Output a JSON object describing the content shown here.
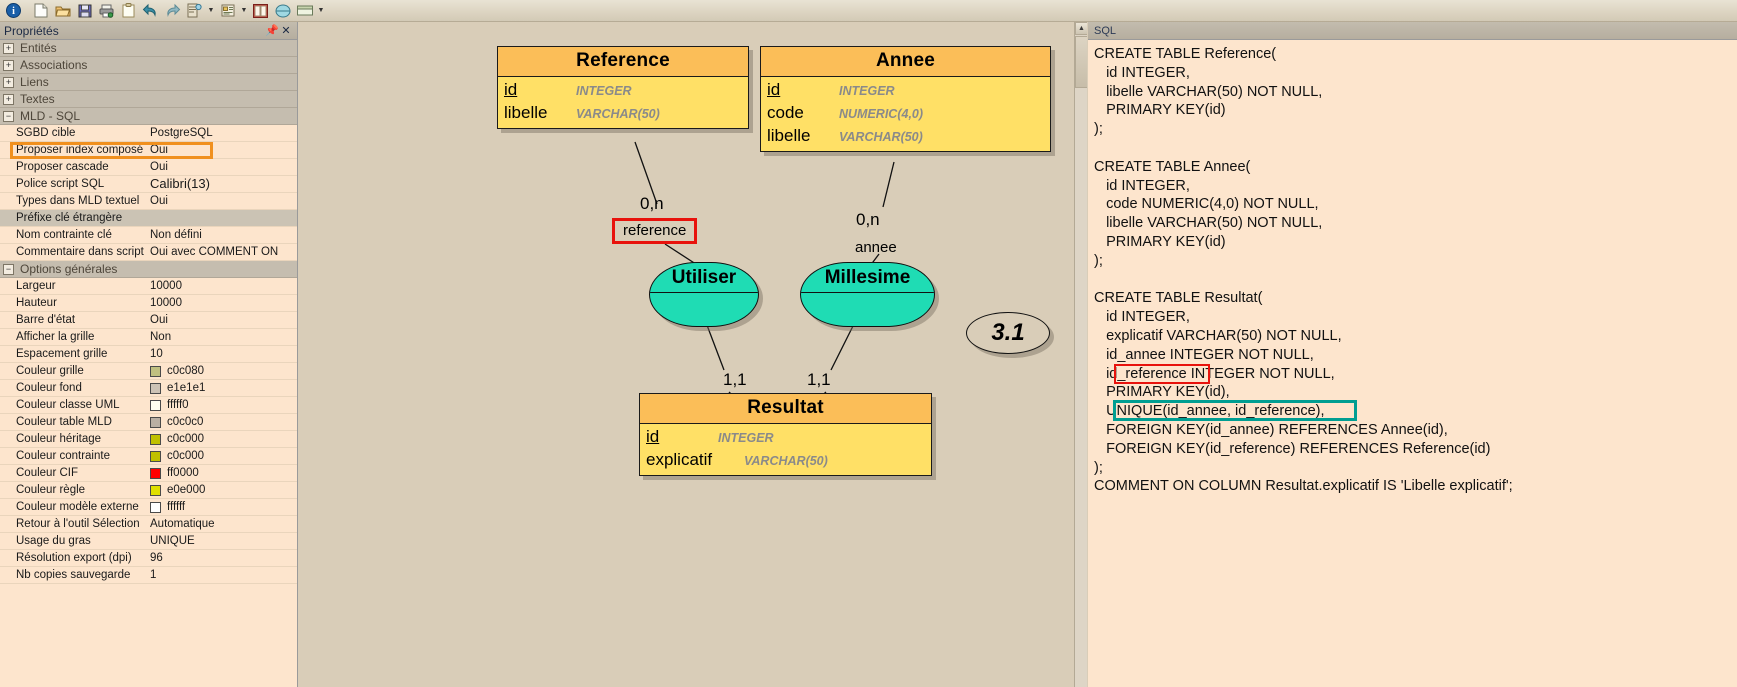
{
  "toolbar": {
    "buttons": [
      {
        "name": "info-icon",
        "glyph": "i"
      },
      {
        "name": "new-file-icon",
        "glyph": "new"
      },
      {
        "name": "open-folder-icon",
        "glyph": "open"
      },
      {
        "name": "save-icon",
        "glyph": "save"
      },
      {
        "name": "print-icon",
        "glyph": "print"
      },
      {
        "name": "clipboard-icon",
        "glyph": "clip"
      },
      {
        "name": "undo-icon",
        "glyph": "undo"
      },
      {
        "name": "redo-icon",
        "glyph": "redo"
      },
      {
        "name": "generate-mld-icon",
        "glyph": "mld"
      },
      {
        "name": "generate-script-icon",
        "glyph": "script"
      },
      {
        "name": "book-icon",
        "glyph": "book"
      },
      {
        "name": "ellipse-tool-icon",
        "glyph": "ellipse"
      },
      {
        "name": "rectangle-tool-icon",
        "glyph": "rect"
      }
    ]
  },
  "properties": {
    "title": "Propriétés",
    "pin_icon": "pin-icon",
    "close_icon": "close-icon",
    "groups": [
      {
        "label": "Entités",
        "expanded": false
      },
      {
        "label": "Associations",
        "expanded": false
      },
      {
        "label": "Liens",
        "expanded": false
      },
      {
        "label": "Textes",
        "expanded": false
      },
      {
        "label": "MLD - SQL",
        "expanded": true
      }
    ],
    "mld_sql_rows": [
      {
        "name": "SGBD cible",
        "value": "PostgreSQL",
        "shaded": false,
        "highlight": false
      },
      {
        "name": "Proposer index composé",
        "value": "Oui",
        "shaded": false,
        "highlight": true
      },
      {
        "name": "Proposer cascade",
        "value": "Oui",
        "shaded": false,
        "highlight": false
      },
      {
        "name": "Police script SQL",
        "value": "Calibri(13)",
        "shaded": false,
        "highlight": false,
        "big": true
      },
      {
        "name": "Types dans MLD textuel",
        "value": "Oui",
        "shaded": false,
        "highlight": false
      },
      {
        "name": "Préfixe clé étrangère",
        "value": "",
        "shaded": true,
        "highlight": false
      },
      {
        "name": "Nom contrainte clé",
        "value": "Non défini",
        "shaded": false,
        "highlight": false
      },
      {
        "name": "Commentaire dans script",
        "value": "Oui avec COMMENT ON",
        "shaded": false,
        "highlight": false
      }
    ],
    "general_group_label": "Options générales",
    "general_rows": [
      {
        "name": "Largeur",
        "value": "10000"
      },
      {
        "name": "Hauteur",
        "value": "10000"
      },
      {
        "name": "Barre d'état",
        "value": "Oui"
      },
      {
        "name": "Afficher la grille",
        "value": "Non"
      },
      {
        "name": "Espacement grille",
        "value": "10"
      },
      {
        "name": "Couleur grille",
        "value": "c0c080",
        "swatch": "#c0c080"
      },
      {
        "name": "Couleur fond",
        "value": "e1e1e1",
        "swatch": "#cdc3b6"
      },
      {
        "name": "Couleur classe UML",
        "value": "fffff0",
        "swatch": "#fffff0"
      },
      {
        "name": "Couleur table MLD",
        "value": "c0c0c0",
        "swatch": "#b9afa3"
      },
      {
        "name": "Couleur héritage",
        "value": "c0c000",
        "swatch": "#c0c000"
      },
      {
        "name": "Couleur contrainte",
        "value": "c0c000",
        "swatch": "#c0c000"
      },
      {
        "name": "Couleur CIF",
        "value": "ff0000",
        "swatch": "#ff0000"
      },
      {
        "name": "Couleur règle",
        "value": "e0e000",
        "swatch": "#e0e000"
      },
      {
        "name": "Couleur modèle externe",
        "value": "ffffff",
        "swatch": "#ffffff"
      },
      {
        "name": "Retour à l'outil Sélection",
        "value": "Automatique"
      },
      {
        "name": "Usage du gras",
        "value": "UNIQUE"
      },
      {
        "name": "Résolution export (dpi)",
        "value": "96"
      },
      {
        "name": "Nb copies sauvegarde",
        "value": "1"
      }
    ]
  },
  "diagram": {
    "entities": [
      {
        "name": "Reference",
        "attributes": [
          {
            "name": "id",
            "type": "INTEGER",
            "pk": true
          },
          {
            "name": "libelle",
            "type": "VARCHAR(50)",
            "pk": false
          }
        ]
      },
      {
        "name": "Annee",
        "attributes": [
          {
            "name": "id",
            "type": "INTEGER",
            "pk": true
          },
          {
            "name": "code",
            "type": "NUMERIC(4,0)",
            "pk": false
          },
          {
            "name": "libelle",
            "type": "VARCHAR(50)",
            "pk": false
          }
        ]
      },
      {
        "name": "Resultat",
        "attributes": [
          {
            "name": "id",
            "type": "INTEGER",
            "pk": true
          },
          {
            "name": "explicatif",
            "type": "VARCHAR(50)",
            "pk": false
          }
        ]
      }
    ],
    "relations": [
      {
        "name": "Utiliser"
      },
      {
        "name": "Millesime"
      }
    ],
    "cardinalities": [
      {
        "text": "0,n",
        "id": "card-reference-top"
      },
      {
        "text": "0,n",
        "id": "card-annee-top"
      },
      {
        "text": "1,1",
        "id": "card-utiliser-bottom"
      },
      {
        "text": "1,1",
        "id": "card-millesime-bottom"
      }
    ],
    "link_labels": [
      {
        "text": "reference",
        "highlighted": true
      },
      {
        "text": "annee",
        "highlighted": false
      }
    ],
    "marker": "3.1"
  },
  "sql": {
    "title": "SQL",
    "lines": [
      "CREATE TABLE Reference(",
      "   id INTEGER,",
      "   libelle VARCHAR(50) NOT NULL,",
      "   PRIMARY KEY(id)",
      ");",
      "",
      "CREATE TABLE Annee(",
      "   id INTEGER,",
      "   code NUMERIC(4,0) NOT NULL,",
      "   libelle VARCHAR(50) NOT NULL,",
      "   PRIMARY KEY(id)",
      ");",
      "",
      "CREATE TABLE Resultat(",
      "   id INTEGER,",
      "   explicatif VARCHAR(50) NOT NULL,",
      "   id_annee INTEGER NOT NULL,",
      "   id_reference INTEGER NOT NULL,",
      "   PRIMARY KEY(id),",
      "   UNIQUE(id_annee, id_reference),",
      "   FOREIGN KEY(id_annee) REFERENCES Annee(id),",
      "   FOREIGN KEY(id_reference) REFERENCES Reference(id)",
      ");",
      "COMMENT ON COLUMN Resultat.explicatif IS 'Libelle explicatif';"
    ],
    "highlights": [
      {
        "type": "red",
        "target": "id_reference"
      },
      {
        "type": "teal",
        "target": "UNIQUE(id_annee, id_reference),"
      }
    ]
  },
  "colors": {
    "entity_header": "#fbbe58",
    "entity_body": "#ffe066",
    "relation_fill": "#1fdcb4",
    "canvas_bg": "#d9cdb8",
    "panel_bg": "#fde5cd",
    "highlight_orange": "#f0901e",
    "highlight_red": "#e8120c",
    "highlight_teal": "#009e92"
  }
}
